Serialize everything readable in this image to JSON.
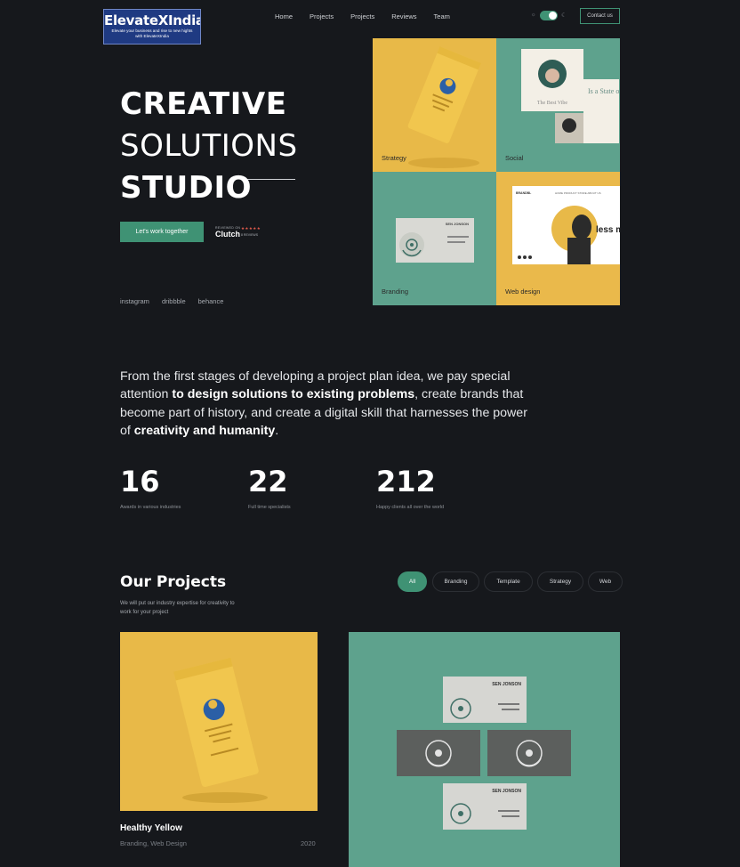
{
  "logo": {
    "brand": "ElevateXIndia",
    "tagline": "Elevate your business and rise to new hights with ElevateXIndia"
  },
  "nav": {
    "items": [
      {
        "label": "Home"
      },
      {
        "label": "Projects"
      },
      {
        "label": "Projects"
      },
      {
        "label": "Reviews"
      },
      {
        "label": "Team"
      }
    ],
    "contact_label": "Contact us",
    "theme_toggle": {
      "state": "on",
      "accent": "#3f9274",
      "icons": [
        "sun-icon",
        "moon-icon"
      ]
    }
  },
  "hero": {
    "line1": "CREATIVE",
    "line2": "SOLUTIONS",
    "line3": "STUDIO",
    "cta_label": "Let's work together",
    "clutch": {
      "reviewed_on": "REVIEWED ON",
      "name": "Clutch",
      "stars": "★★★★★",
      "reviews": "8 REVIEWS"
    },
    "socials": [
      "instagram",
      "dribbble",
      "behance"
    ]
  },
  "tiles": {
    "strategy": "Strategy",
    "social": "Social",
    "branding": "Branding",
    "web": "Web design",
    "social_card_text": "The Best Vibe",
    "social_quote": "Is a State of Mind",
    "card_name": "SEN JONSON",
    "web_logo": "BRANDBL",
    "web_nav": "HOME  PRODUCT  STORE  ABOUT US",
    "web_headline": "less more"
  },
  "intro": {
    "part1": "From the first stages of developing a project plan idea, we pay special attention ",
    "bold1": "to design solutions to existing problems",
    "part2": ", create brands that become part of history, and create a digital skill that harnesses the power of ",
    "bold2": "creativity and humanity",
    "part3": "."
  },
  "stats": [
    {
      "value": "16",
      "caption": "Awards in various industries"
    },
    {
      "value": "22",
      "caption": "Full time specialists"
    },
    {
      "value": "212",
      "caption": "Happy clients all over the world"
    }
  ],
  "projects": {
    "title": "Our Projects",
    "subtitle": "We will put our industry expertise for creativity to work for your project",
    "filters": [
      "All",
      "Branding",
      "Template",
      "Strategy",
      "Web"
    ],
    "active_filter": "All",
    "items": [
      {
        "name": "Healthy Yellow",
        "categories": "Branding, Web Design",
        "year": "2020"
      },
      {
        "card_name": "SEN JONSON"
      }
    ]
  },
  "colors": {
    "background": "#16181c",
    "accent": "#3f9274",
    "yellow": "#e8b948",
    "teal": "#5ea28d"
  }
}
